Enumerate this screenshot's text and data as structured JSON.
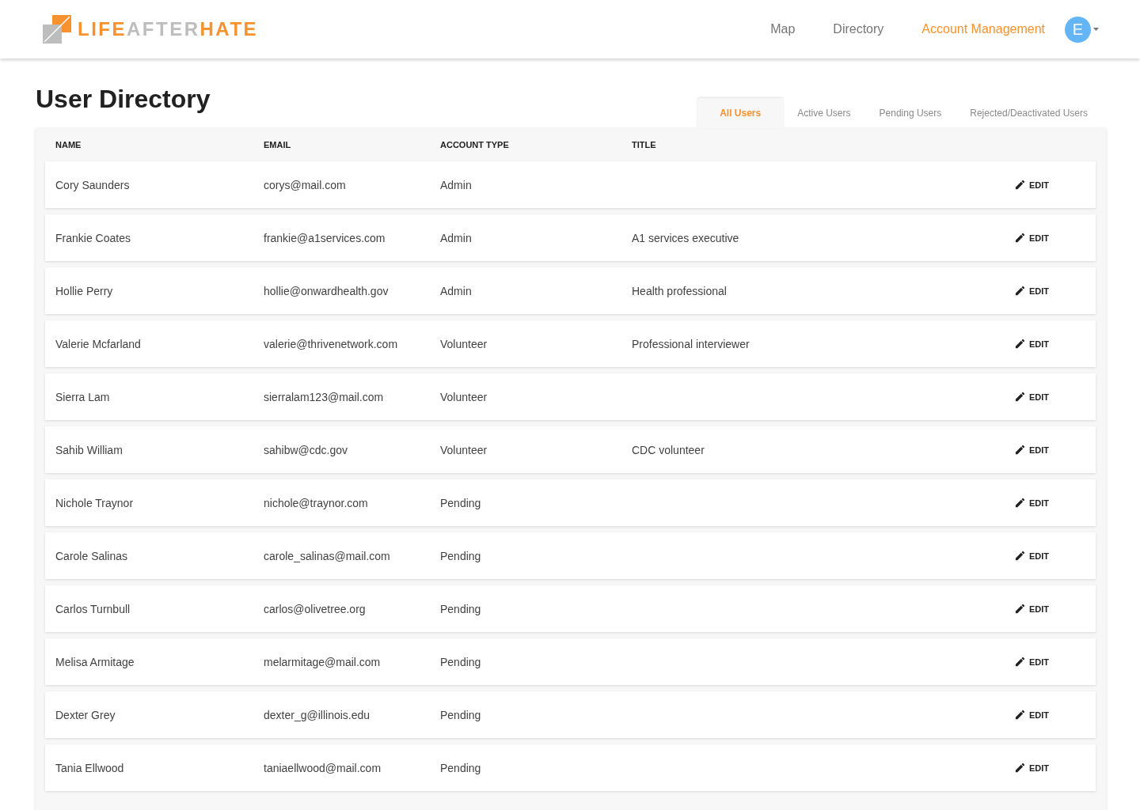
{
  "logo": {
    "parts": [
      {
        "text": "LIFE",
        "color": "#f7922f"
      },
      {
        "text": "AFTER",
        "color": "#bdbdbd"
      },
      {
        "text": "HATE",
        "color": "#f7922f"
      }
    ]
  },
  "nav": [
    {
      "label": "Map",
      "selected": false
    },
    {
      "label": "Directory",
      "selected": false
    },
    {
      "label": "Account Management",
      "selected": true
    }
  ],
  "avatar": {
    "initial": "E"
  },
  "page_title": "User Directory",
  "tabs": [
    {
      "label": "All Users",
      "selected": true
    },
    {
      "label": "Active Users",
      "selected": false
    },
    {
      "label": "Pending Users",
      "selected": false
    },
    {
      "label": "Rejected/Deactivated Users",
      "selected": false
    }
  ],
  "table": {
    "columns": [
      "NAME",
      "EMAIL",
      "ACCOUNT TYPE",
      "TITLE"
    ],
    "rows": [
      {
        "name": "Cory Saunders",
        "email": "corys@mail.com",
        "account_type": "Admin",
        "title": "",
        "edit_label": "EDIT"
      },
      {
        "name": "Frankie Coates",
        "email": "frankie@a1services.com",
        "account_type": "Admin",
        "title": "A1 services executive",
        "edit_label": "EDIT"
      },
      {
        "name": "Hollie Perry",
        "email": "hollie@onwardhealth.gov",
        "account_type": "Admin",
        "title": "Health professional",
        "edit_label": "EDIT"
      },
      {
        "name": "Valerie Mcfarland",
        "email": "valerie@thrivenetwork.com",
        "account_type": "Volunteer",
        "title": "Professional interviewer",
        "edit_label": "EDIT"
      },
      {
        "name": "Sierra Lam",
        "email": "sierralam123@mail.com",
        "account_type": "Volunteer",
        "title": "",
        "edit_label": "EDIT"
      },
      {
        "name": "Sahib William",
        "email": "sahibw@cdc.gov",
        "account_type": "Volunteer",
        "title": "CDC volunteer",
        "edit_label": "EDIT"
      },
      {
        "name": "Nichole Traynor",
        "email": "nichole@traynor.com",
        "account_type": "Pending",
        "title": "",
        "edit_label": "EDIT"
      },
      {
        "name": "Carole Salinas",
        "email": "carole_salinas@mail.com",
        "account_type": "Pending",
        "title": "",
        "edit_label": "EDIT"
      },
      {
        "name": "Carlos Turnbull",
        "email": "carlos@olivetree.org",
        "account_type": "Pending",
        "title": "",
        "edit_label": "EDIT"
      },
      {
        "name": "Melisa Armitage",
        "email": "melarmitage@mail.com",
        "account_type": "Pending",
        "title": "",
        "edit_label": "EDIT"
      },
      {
        "name": "Dexter Grey",
        "email": "dexter_g@illinois.edu",
        "account_type": "Pending",
        "title": "",
        "edit_label": "EDIT"
      },
      {
        "name": "Tania Ellwood",
        "email": "taniaellwood@mail.com",
        "account_type": "Pending",
        "title": "",
        "edit_label": "EDIT"
      }
    ]
  }
}
